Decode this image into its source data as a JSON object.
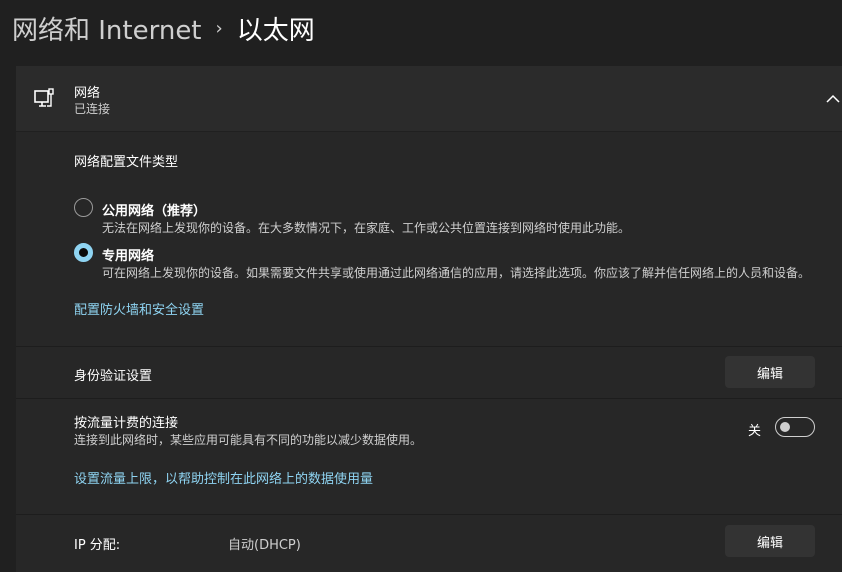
{
  "breadcrumb": {
    "parent": "网络和 Internet",
    "separator": "›",
    "current": "以太网"
  },
  "network": {
    "name": "网络",
    "status": "已连接",
    "icon": "ethernet-monitor-icon"
  },
  "profile": {
    "heading": "网络配置文件类型",
    "options": [
      {
        "label": "公用网络（推荐）",
        "desc": "无法在网络上发现你的设备。在大多数情况下，在家庭、工作或公共位置连接到网络时使用此功能。",
        "selected": false
      },
      {
        "label": "专用网络",
        "desc": "可在网络上发现你的设备。如果需要文件共享或使用通过此网络通信的应用，请选择此选项。你应该了解并信任网络上的人员和设备。",
        "selected": true
      }
    ],
    "firewall_link": "配置防火墙和安全设置"
  },
  "auth": {
    "label": "身份验证设置",
    "button": "编辑"
  },
  "metered": {
    "label": "按流量计费的连接",
    "desc": "连接到此网络时，某些应用可能具有不同的功能以减少数据使用。",
    "state": "关",
    "on": false,
    "link": "设置流量上限，以帮助控制在此网络上的数据使用量"
  },
  "ip": {
    "label": "IP 分配:",
    "value": "自动(DHCP)",
    "button": "编辑"
  },
  "colors": {
    "accent": "#8fd4f2"
  }
}
